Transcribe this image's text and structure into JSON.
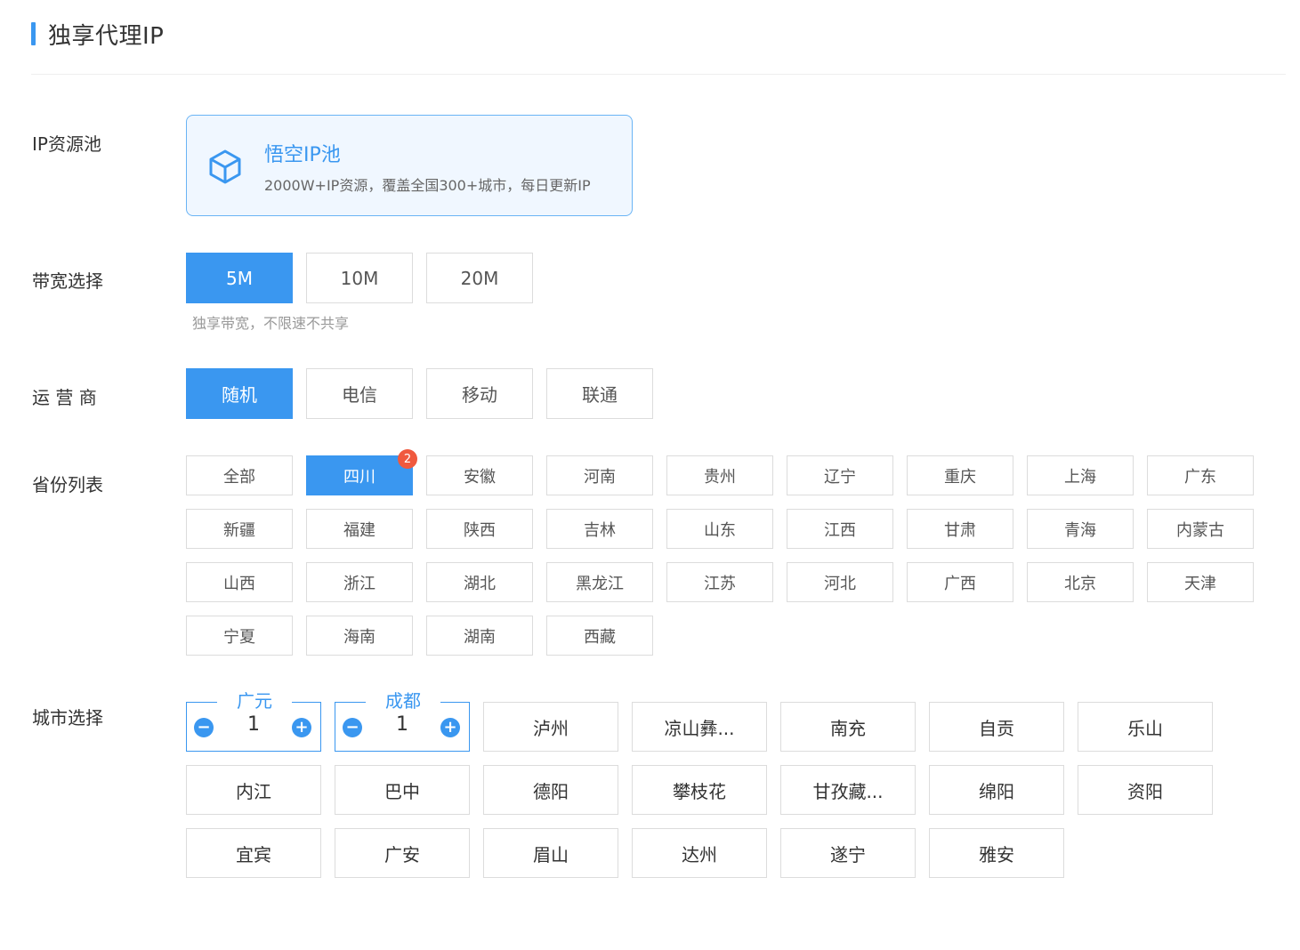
{
  "header": {
    "title": "独享代理IP"
  },
  "labels": {
    "ip_pool": "IP资源池",
    "bandwidth": "带宽选择",
    "carrier": "运 营 商",
    "province": "省份列表",
    "city": "城市选择"
  },
  "pool": {
    "icon": "cube-icon",
    "title": "悟空IP池",
    "desc": "2000W+IP资源，覆盖全国300+城市，每日更新IP"
  },
  "bandwidth": {
    "options": [
      "5M",
      "10M",
      "20M"
    ],
    "selected": "5M",
    "hint": "独享带宽，不限速不共享"
  },
  "carrier": {
    "options": [
      "随机",
      "电信",
      "移动",
      "联通"
    ],
    "selected": "随机"
  },
  "provinces": {
    "items": [
      "全部",
      "四川",
      "安徽",
      "河南",
      "贵州",
      "辽宁",
      "重庆",
      "上海",
      "广东",
      "新疆",
      "福建",
      "陕西",
      "吉林",
      "山东",
      "江西",
      "甘肃",
      "青海",
      "内蒙古",
      "山西",
      "浙江",
      "湖北",
      "黑龙江",
      "江苏",
      "河北",
      "广西",
      "北京",
      "天津",
      "宁夏",
      "海南",
      "湖南",
      "西藏"
    ],
    "selected": "四川",
    "selected_badge": "2"
  },
  "cities": {
    "selected": [
      {
        "name": "广元",
        "qty": "1"
      },
      {
        "name": "成都",
        "qty": "1"
      }
    ],
    "items": [
      "泸州",
      "凉山彝...",
      "南充",
      "自贡",
      "乐山",
      "内江",
      "巴中",
      "德阳",
      "攀枝花",
      "甘孜藏...",
      "绵阳",
      "资阳",
      "宜宾",
      "广安",
      "眉山",
      "达州",
      "遂宁",
      "雅安"
    ],
    "minus_symbol": "−",
    "plus_symbol": "+"
  },
  "colors": {
    "accent": "#3a97f0",
    "badge": "#f0593e"
  }
}
